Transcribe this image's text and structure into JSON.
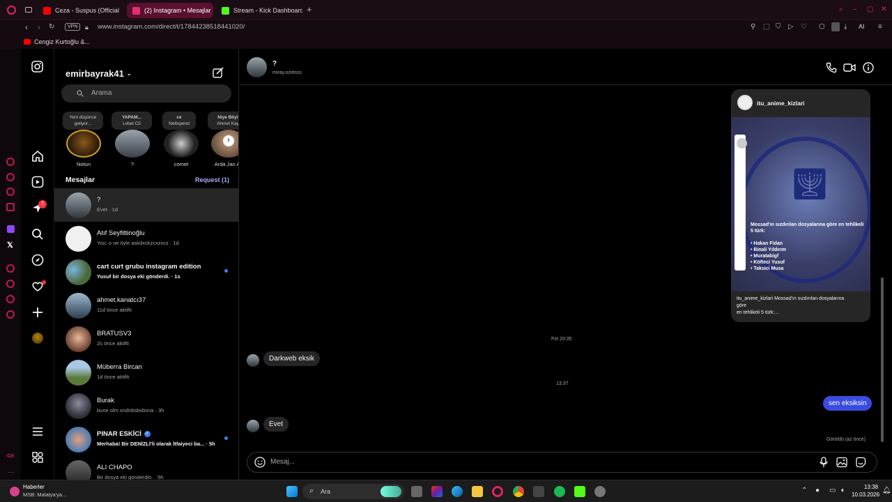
{
  "browser": {
    "tabs": [
      {
        "label": "Ceza - Suspus (Official M",
        "color": "#ff0000"
      },
      {
        "label": "(2) Instagram • Mesajlar",
        "color": "#e1306c"
      },
      {
        "label": "Stream - Kick Dashboard",
        "color": "#53fc18"
      }
    ],
    "address": "www.instagram.com/direct/t/17844238518441020/",
    "vpn": "VPN",
    "bookmark": "Cengiz Kurtoğlu &...",
    "ai_label": "AI"
  },
  "opera_side": {
    "badge": "GX"
  },
  "nav": {
    "messages_badge": "2"
  },
  "sidebar": {
    "username": "emirbayrak41",
    "search_placeholder": "Arama",
    "notes": [
      {
        "note_line1": "Yeni düşünce",
        "note_line2": "geliyor...",
        "name": "Notun"
      },
      {
        "note_line1": "YAPAM...",
        "note_line2": "Lvbel C5",
        "name": "?"
      },
      {
        "note_line1": "ce",
        "note_line2": "Nettspend",
        "name": "comet"
      },
      {
        "note_line1": "Niye Böyl",
        "note_line2": "Ahmet Kay",
        "name": "Arda Jan Ak"
      }
    ],
    "messages_heading": "Mesajlar",
    "request_link": "Request (1)",
    "conversations": [
      {
        "name": "?",
        "preview": "Evet · 1d"
      },
      {
        "name": "Atıf Seyfittinoğlu",
        "preview": "You: o ne öyle askdxckzcxzxcz · 1d"
      },
      {
        "name": "cart curt grubu instagram edition",
        "preview": "Yusuf bir dosya eki gönderdi. · 1s"
      },
      {
        "name": "ahmet.kanatcı37",
        "preview": "11d önce aktifti"
      },
      {
        "name": "BRATUSV3",
        "preview": "2s önce aktifti"
      },
      {
        "name": "Müberra Bircan",
        "preview": "1d önce aktifti"
      },
      {
        "name": "Burak",
        "preview": "bune olm sndnbsbxbsna · 3h"
      },
      {
        "name": "PINAR ESKİCİ",
        "preview": "Merhaba! Bir DENİZLİ'li olarak İtfaiyeci ba... · 5h"
      },
      {
        "name": "ALI CHAPO",
        "preview": "Bir dosya eki gönderdin. · 5h"
      }
    ]
  },
  "chat": {
    "contact_name": "?",
    "contact_username": "miray.ozelsss",
    "shared_post": {
      "author": "itu_anime_kizlari",
      "image_text_title": "Mossad'ın sızdırılan dosyalarına göre en tehlikeli 5 türk:",
      "image_text_list": [
        "• Hakan Fidan",
        "• Binali Yıldırım",
        "• Muratabigf",
        "• Köfteci Yusuf",
        "• Taksici Musa"
      ],
      "caption_line1": "itu_anime_kizlari Mossad'ın sızdırılan dosyalarına",
      "caption_line2": "göre",
      "caption_line3": "en tehlikeli 5 türk:..."
    },
    "timestamp1": "Pzt 20:35",
    "msg1": "Darkweb eksik",
    "timestamp2": "13:37",
    "msg2_out": "sen eksiksin",
    "msg3": "Evet",
    "seen": "Görüldü (az önce)",
    "composer_placeholder": "Mesaj..."
  },
  "taskbar": {
    "news_title": "Haberler",
    "news_sub": "MSB: Malatya'ya...",
    "search": "Ara",
    "time": "13:38",
    "date": "10.03.2026"
  }
}
